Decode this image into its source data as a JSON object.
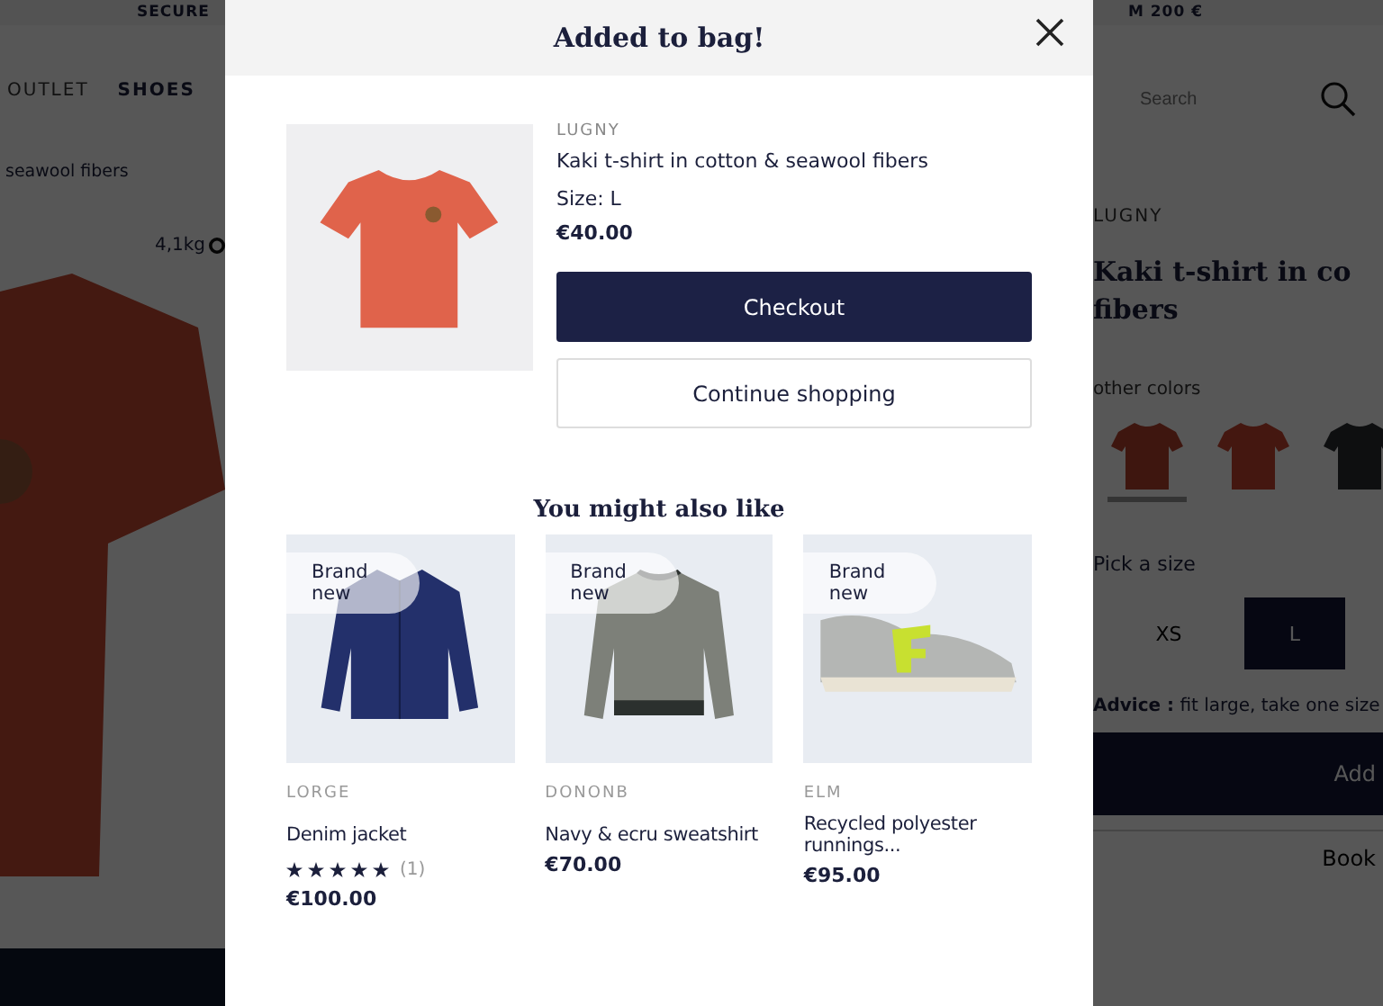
{
  "page": {
    "top_bar": [
      "SECURE",
      "M 200 €"
    ],
    "nav": [
      "OUTLET",
      "SHOES"
    ],
    "search": {
      "placeholder": "Search"
    },
    "breadcrumb": "seawool fibers",
    "weight": "4,1kg",
    "product": {
      "brand": "LUGNY",
      "title": "Kaki t-shirt in co\nfibers",
      "colors_label": "other colors",
      "swatches": [
        {
          "selected": true
        },
        {
          "selected": false
        },
        {
          "selected": false
        }
      ],
      "size_label": "Pick a size",
      "sizes": [
        {
          "label": "XS",
          "selected": false
        },
        {
          "label": "L",
          "selected": true
        }
      ],
      "advice": "**Advice :** fit large, take one size",
      "add_button": "Add",
      "book_button": "Book"
    }
  },
  "modal": {
    "title": "Added to bag!",
    "item": {
      "kind": "tshirt",
      "brand": "LUGNY",
      "name": "Kaki t-shirt in cotton & seawool fibers",
      "size": "Size: L",
      "price": "€40.00"
    },
    "buttons": [
      {
        "kind": "primary",
        "label": "Checkout"
      },
      {
        "kind": "secondary",
        "label": "Continue shopping"
      }
    ],
    "recommendations_title": "You might also like",
    "recommendations": [
      {
        "kind": "jacket",
        "badge": "Brand new",
        "brand": "LORGE",
        "name": "Denim jacket",
        "stars": 5,
        "reviews": "(1)",
        "price": "€100.00"
      },
      {
        "kind": "sweater",
        "badge": "Brand new",
        "brand": "DONONB",
        "name": "Navy & ecru sweatshirt",
        "price": "€70.00"
      },
      {
        "kind": "sneaker",
        "badge": "Brand new",
        "brand": "ELM",
        "name": "Recycled polyester runnings...",
        "price": "€95.00"
      }
    ]
  }
}
